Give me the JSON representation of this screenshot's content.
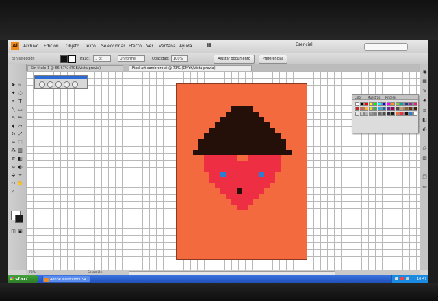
{
  "app": {
    "logo_text": "Ai",
    "menu": [
      "Archivo",
      "Edición",
      "Objeto",
      "Texto",
      "Seleccionar",
      "Efecto",
      "Ver",
      "Ventana",
      "Ayuda"
    ],
    "workspace_label": "Esencial"
  },
  "control_bar": {
    "selection_label": "Sin selección",
    "stroke_label": "Trazo:",
    "stroke_value": "1 pt",
    "brush_label": "Uniforme",
    "opacity_label": "Opacidad:",
    "opacity_value": "100%",
    "doc_setup_button": "Ajustar documento",
    "prefs_button": "Preferencias"
  },
  "document": {
    "tabs": [
      {
        "label": "Sin título-1 @ 66,67% (RGB/Vista previa)",
        "active": false
      },
      {
        "label": "Pixel art sombrero.ai @ 73% (CMYK/Vista previa)",
        "active": true
      }
    ]
  },
  "artwork": {
    "background_color": "#f26a3e",
    "hat_color": "#241009",
    "heart_color": "#ee2f43",
    "eye_color": "#2a7fd4",
    "mouth_color": "#241009"
  },
  "color_panel": {
    "tabs": [
      "Color",
      "Muestras",
      "Pinceles"
    ]
  },
  "status": {
    "zoom": "73%",
    "tool_name": "Selección"
  },
  "taskbar": {
    "start_label": "start",
    "task_button": "Adobe Illustrator CS4...",
    "clock": "10:47"
  },
  "colors": {
    "accent": "#2c6bd6",
    "taskbar": "#2456c8",
    "start": "#3a9233"
  },
  "icons": {
    "tools": [
      "selection-icon",
      "direct-selection-icon",
      "magic-wand-icon",
      "lasso-icon",
      "pen-icon",
      "type-icon",
      "line-icon",
      "rectangle-icon",
      "brush-icon",
      "pencil-icon",
      "blob-brush-icon",
      "eraser-icon",
      "rotate-icon",
      "scale-icon",
      "warp-icon",
      "free-transform-icon",
      "symbol-sprayer-icon",
      "graph-icon",
      "mesh-icon",
      "gradient-icon",
      "eyedropper-icon",
      "blend-icon",
      "live-paint-icon",
      "slice-icon",
      "scissors-icon",
      "hand-icon",
      "zoom-icon"
    ]
  }
}
